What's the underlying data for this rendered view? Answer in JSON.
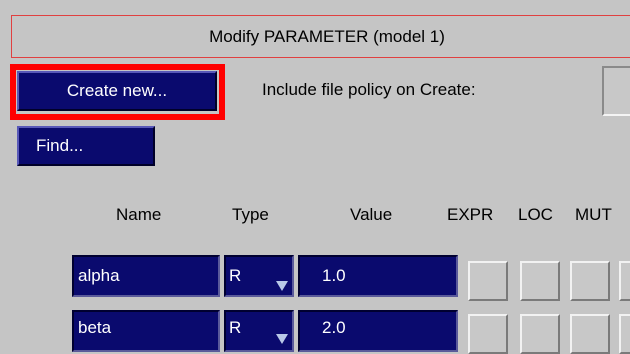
{
  "window": {
    "title": "Modify PARAMETER (model 1)"
  },
  "toolbar": {
    "create_label": "Create new...",
    "find_label": "Find...",
    "policy_label": "Include file policy on Create:"
  },
  "columns": [
    "Name",
    "Type",
    "Value",
    "EXPR",
    "LOC",
    "MUT"
  ],
  "rows": [
    {
      "name": "alpha",
      "type": "R",
      "value": "1.0"
    },
    {
      "name": "beta",
      "type": "R",
      "value": "2.0"
    }
  ],
  "colors": {
    "background": "#c5c5c5",
    "button_blue": "#0a0a6e",
    "highlight": "#ff0000",
    "title_border": "#e04040"
  }
}
